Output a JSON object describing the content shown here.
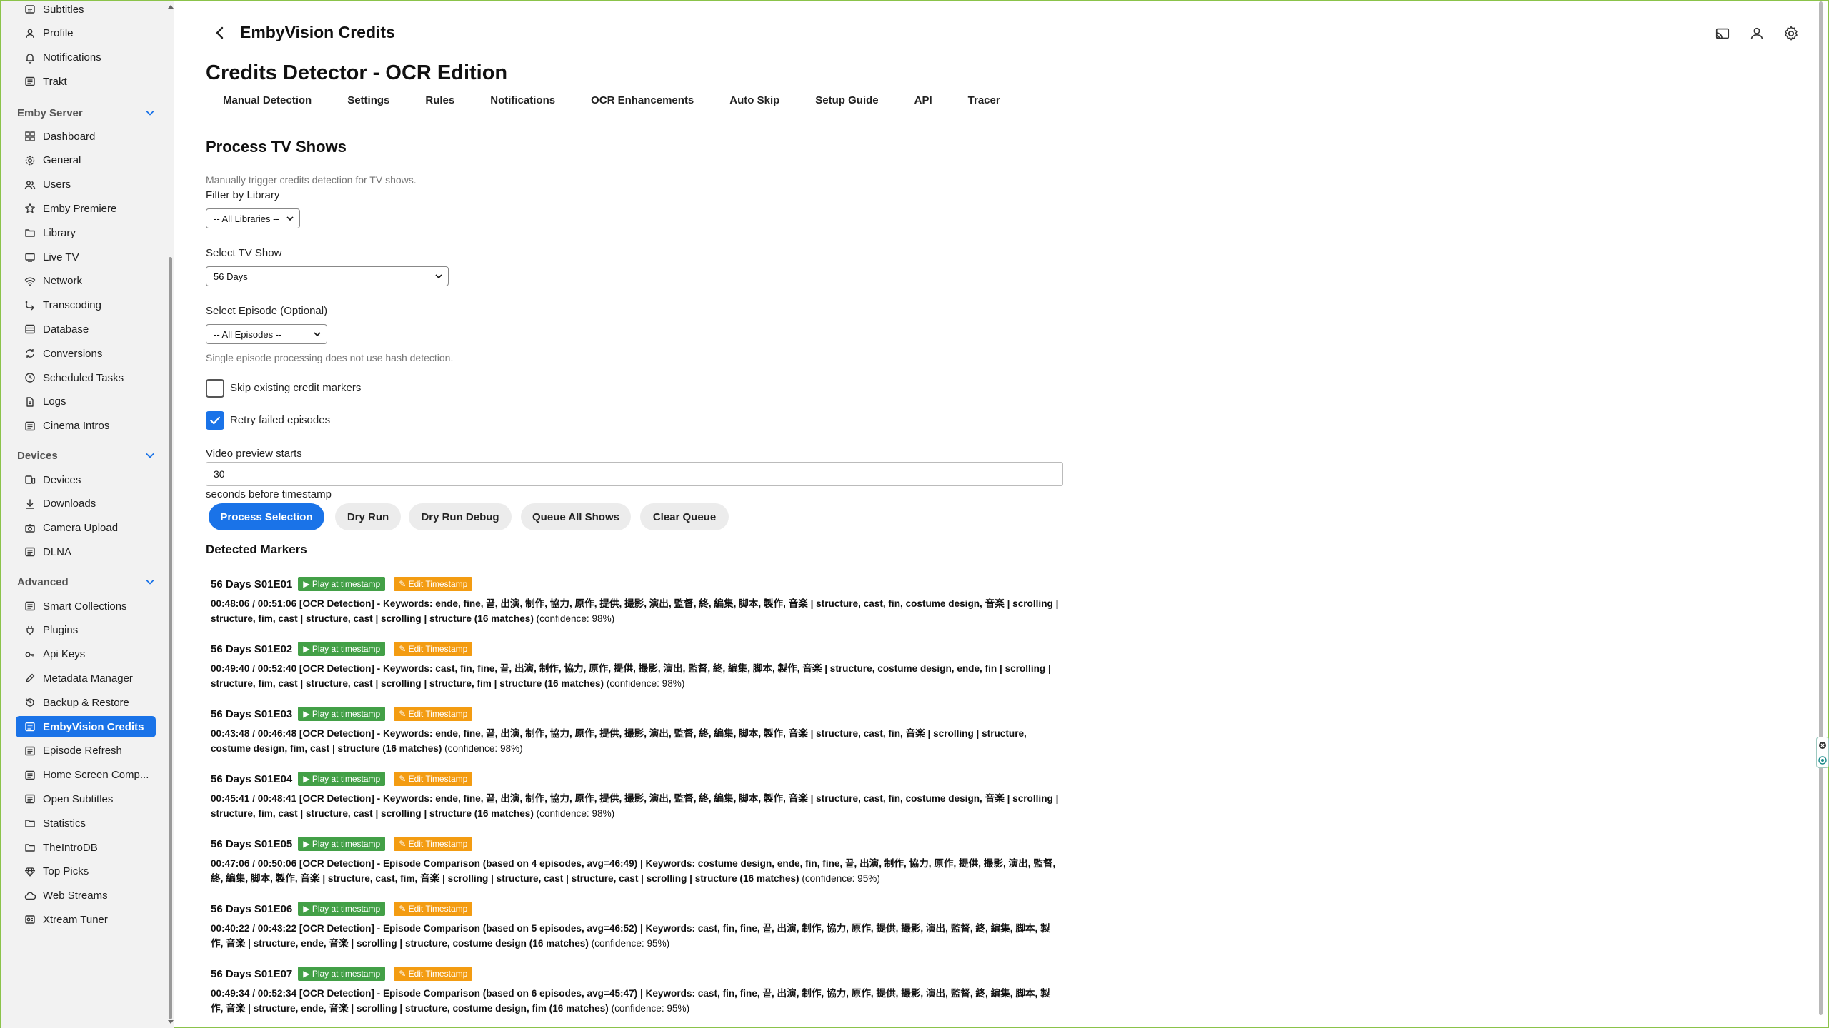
{
  "sidebar": {
    "items_top": [
      {
        "label": "Subtitles",
        "icon": "subtitles-icon"
      },
      {
        "label": "Profile",
        "icon": "person-icon"
      },
      {
        "label": "Notifications",
        "icon": "bell-icon"
      },
      {
        "label": "Trakt",
        "icon": "list-icon"
      }
    ],
    "sections": [
      {
        "title": "Emby Server"
      },
      {
        "title": "Devices"
      },
      {
        "title": "Advanced"
      }
    ],
    "server_items": [
      {
        "label": "Dashboard",
        "icon": "dashboard-icon"
      },
      {
        "label": "General",
        "icon": "gear-icon"
      },
      {
        "label": "Users",
        "icon": "users-icon"
      },
      {
        "label": "Emby Premiere",
        "icon": "star-icon"
      },
      {
        "label": "Library",
        "icon": "folder-icon"
      },
      {
        "label": "Live TV",
        "icon": "tv-icon"
      },
      {
        "label": "Network",
        "icon": "wifi-icon"
      },
      {
        "label": "Transcoding",
        "icon": "transcode-icon"
      },
      {
        "label": "Database",
        "icon": "database-icon"
      },
      {
        "label": "Conversions",
        "icon": "convert-icon"
      },
      {
        "label": "Scheduled Tasks",
        "icon": "clock-icon"
      },
      {
        "label": "Logs",
        "icon": "file-icon"
      },
      {
        "label": "Cinema Intros",
        "icon": "list-icon"
      }
    ],
    "device_items": [
      {
        "label": "Devices",
        "icon": "devices-icon"
      },
      {
        "label": "Downloads",
        "icon": "download-icon"
      },
      {
        "label": "Camera Upload",
        "icon": "camera-icon"
      },
      {
        "label": "DLNA",
        "icon": "list-icon"
      }
    ],
    "advanced_items": [
      {
        "label": "Smart Collections",
        "icon": "list-icon"
      },
      {
        "label": "Plugins",
        "icon": "plugin-icon"
      },
      {
        "label": "Api Keys",
        "icon": "key-icon"
      },
      {
        "label": "Metadata Manager",
        "icon": "pencil-icon"
      },
      {
        "label": "Backup & Restore",
        "icon": "restore-icon"
      },
      {
        "label": "EmbyVision Credits",
        "icon": "list-icon"
      },
      {
        "label": "Episode Refresh",
        "icon": "list-icon"
      },
      {
        "label": "Home Screen Comp...",
        "icon": "list-icon"
      },
      {
        "label": "Open Subtitles",
        "icon": "list-icon"
      },
      {
        "label": "Statistics",
        "icon": "folder-icon"
      },
      {
        "label": "TheIntroDB",
        "icon": "folder-icon"
      },
      {
        "label": "Top Picks",
        "icon": "diamond-icon"
      },
      {
        "label": "Web Streams",
        "icon": "cloud-icon"
      },
      {
        "label": "Xtream Tuner",
        "icon": "tuner-icon"
      }
    ]
  },
  "header": {
    "title": "EmbyVision Credits"
  },
  "page": {
    "title": "Credits Detector - OCR Edition",
    "tabs": [
      "Manual Detection",
      "Settings",
      "Rules",
      "Notifications",
      "OCR Enhancements",
      "Auto Skip",
      "Setup Guide",
      "API",
      "Tracer"
    ],
    "section_title": "Process TV Shows",
    "section_desc": "Manually trigger credits detection for TV shows.",
    "filter_label": "Filter by Library",
    "filter_value": "-- All Libraries --",
    "show_label": "Select TV Show",
    "show_value": "56 Days",
    "episode_label": "Select Episode (Optional)",
    "episode_value": "-- All Episodes --",
    "episode_hint": "Single episode processing does not use hash detection.",
    "skip_label": "Skip existing credit markers",
    "retry_label": "Retry failed episodes",
    "preview_label": "Video preview starts",
    "preview_value": "30",
    "preview_suffix": "seconds before timestamp",
    "buttons": {
      "process": "Process Selection",
      "dry_run": "Dry Run",
      "dry_run_debug": "Dry Run Debug",
      "queue_all": "Queue All Shows",
      "clear_queue": "Clear Queue"
    },
    "markers_title": "Detected Markers",
    "play_label": "▶ Play at timestamp",
    "edit_label": "✎ Edit Timestamp",
    "markers": [
      {
        "episode": "56 Days S01E01",
        "text": "00:48:06 / 00:51:06 [OCR Detection] - Keywords: ende, fine, 끝, 出演, 制作, 協力, 原作, 提供, 撮影, 演出, 監督, 終, 編集, 脚本, 製作, 音楽 | structure, cast, fin, costume design, 音楽 | scrolling | structure, fim, cast | structure, cast | scrolling | structure (16 matches)",
        "confidence": "(confidence: 98%)"
      },
      {
        "episode": "56 Days S01E02",
        "text": "00:49:40 / 00:52:40 [OCR Detection] - Keywords: cast, fin, fine, 끝, 出演, 制作, 協力, 原作, 提供, 撮影, 演出, 監督, 終, 編集, 脚本, 製作, 音楽 | structure, costume design, ende, fin | scrolling | structure, fim, cast | structure, cast | scrolling | structure, fim | structure (16 matches)",
        "confidence": "(confidence: 98%)"
      },
      {
        "episode": "56 Days S01E03",
        "text": "00:43:48 / 00:46:48 [OCR Detection] - Keywords: ende, fine, 끝, 出演, 制作, 協力, 原作, 提供, 撮影, 演出, 監督, 終, 編集, 脚本, 製作, 音楽 | structure, cast, fin, 音楽 | scrolling | structure, costume design, fim, cast | structure (16 matches)",
        "confidence": "(confidence: 98%)"
      },
      {
        "episode": "56 Days S01E04",
        "text": "00:45:41 / 00:48:41 [OCR Detection] - Keywords: ende, fine, 끝, 出演, 制作, 協力, 原作, 提供, 撮影, 演出, 監督, 終, 編集, 脚本, 製作, 音楽 | structure, cast, fin, costume design, 音楽 | scrolling | structure, fim, cast | structure, cast | scrolling | structure (16 matches)",
        "confidence": "(confidence: 98%)"
      },
      {
        "episode": "56 Days S01E05",
        "text": "00:47:06 / 00:50:06 [OCR Detection] - Episode Comparison (based on 4 episodes, avg=46:49) | Keywords: costume design, ende, fin, fine, 끝, 出演, 制作, 協力, 原作, 提供, 撮影, 演出, 監督, 終, 編集, 脚本, 製作, 音楽 | structure, cast, fim, 音楽 | scrolling | structure, cast | structure, cast | scrolling | structure (16 matches)",
        "confidence": "(confidence: 95%)"
      },
      {
        "episode": "56 Days S01E06",
        "text": "00:40:22 / 00:43:22 [OCR Detection] - Episode Comparison (based on 5 episodes, avg=46:52) | Keywords: cast, fin, fine, 끝, 出演, 制作, 協力, 原作, 提供, 撮影, 演出, 監督, 終, 編集, 脚本, 製作, 音楽 | structure, ende, 音楽 | scrolling | structure, costume design (16 matches)",
        "confidence": "(confidence: 95%)"
      },
      {
        "episode": "56 Days S01E07",
        "text": "00:49:34 / 00:52:34 [OCR Detection] - Episode Comparison (based on 6 episodes, avg=45:47) | Keywords: cast, fin, fine, 끝, 出演, 制作, 協力, 原作, 提供, 撮影, 演出, 監督, 終, 編集, 脚本, 製作, 音楽 | structure, ende, 音楽 | scrolling | structure, costume design, fim (16 matches)",
        "confidence": "(confidence: 95%)"
      }
    ]
  },
  "colors": {
    "accent": "#1a73e8",
    "play": "#43a047",
    "edit": "#f39c12",
    "window_border": "#8bc34a"
  }
}
